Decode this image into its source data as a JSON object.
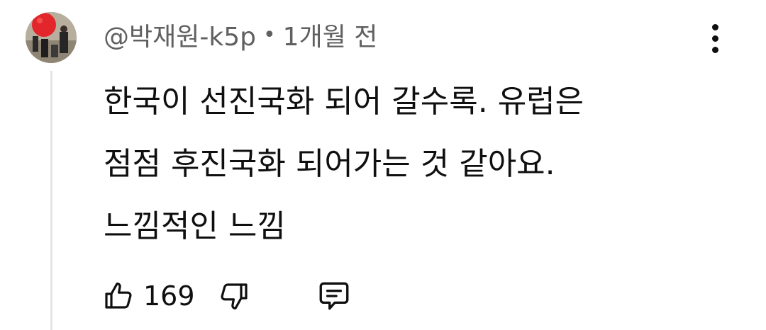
{
  "comment": {
    "author": "@박재원-k5p",
    "separator": "•",
    "time": "1개월 전",
    "body_lines": [
      "한국이 선진국화 되어 갈수록. 유럽은",
      "점점 후진국화 되어가는 것 같아요.",
      "느낌적인 느낌"
    ],
    "like_count": "169"
  },
  "icons": {
    "avatar": "avatar-image",
    "more": "more-vertical-icon",
    "like": "thumbs-up-icon",
    "dislike": "thumbs-down-icon",
    "reply": "reply-comment-icon"
  },
  "colors": {
    "text_primary": "#0f0f0f",
    "text_secondary": "#606060",
    "thread_line": "#e4e4e4"
  }
}
